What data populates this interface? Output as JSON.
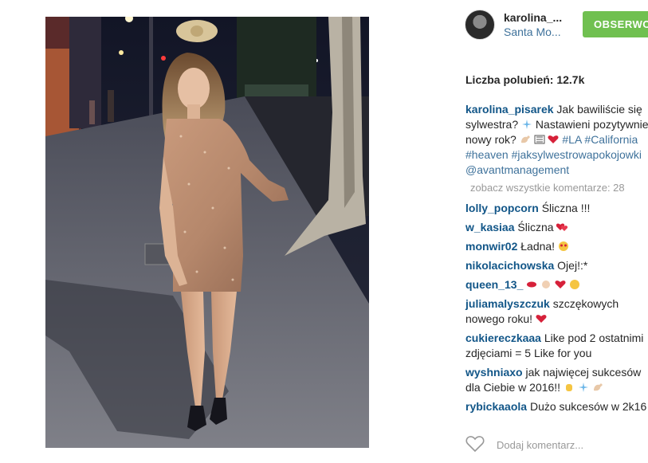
{
  "post": {
    "author": "karolina_...",
    "location": "Santa Mo...",
    "follow_label": "OBSERWO",
    "likes": "Liczba polubień: 12.7k"
  },
  "caption": {
    "user": "karolina_pisarek",
    "text_1": "Jak bawiliście się",
    "text_2": "sylwestra?",
    "text_3": "Nastawieni pozytywnie",
    "text_4": "nowy rok?",
    "tag_la": "#LA",
    "tag_ca": "#California",
    "tag_heaven": "#heaven",
    "tag_jsp": "#jaksylwestrowapokojowki",
    "tag_avant": "@avantmanagement"
  },
  "view_all": "zobacz wszystkie komentarze: 28",
  "comments": [
    {
      "user": "lolly_popcorn",
      "text": "Śliczna !!!"
    },
    {
      "user": "w_kasiaa",
      "text": "Śliczna"
    },
    {
      "user": "monwir02",
      "text": "Ładna!"
    },
    {
      "user": "nikolacichowska",
      "text": "Ojej!:*"
    },
    {
      "user": "queen_13_",
      "text": ""
    },
    {
      "user": "juliamalyszczuk",
      "text": "szczękowych nowego roku!"
    },
    {
      "user": "cukiereczkaaa",
      "text": "Like pod 2 ostatnimi zdjęciami = 5 Like for you"
    },
    {
      "user": "wyshniaxo",
      "text": "jak najwięcej sukcesów dla Ciebie w 2016!!"
    },
    {
      "user": "rybickaaola",
      "text": "Dużo sukcesów w 2k16"
    }
  ],
  "footer": {
    "add_comment": "Dodaj komentarz..."
  },
  "icons": {
    "like": "heart-icon"
  },
  "colors": {
    "follow": "#70c050",
    "username": "#125688",
    "link": "#3f729b"
  }
}
